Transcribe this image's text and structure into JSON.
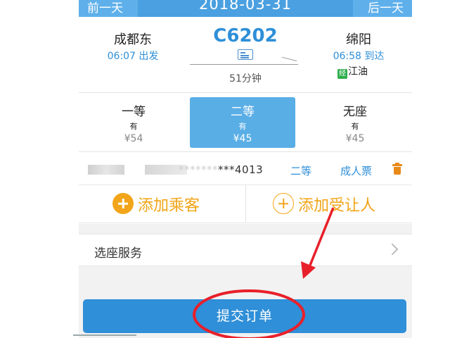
{
  "date_bar": {
    "prev_label": "前一天",
    "date": "2018-03-31",
    "next_label": "后一天"
  },
  "train": {
    "from_station": "成都东",
    "from_time": "06:07 出发",
    "train_no": "C6202",
    "duration": "51分钟",
    "to_station": "绵阳",
    "to_time": "06:58 到达",
    "via_badge": "经",
    "via_station": "江油"
  },
  "seats": [
    {
      "name": "一等",
      "availability": "有",
      "price": "¥54",
      "selected": false
    },
    {
      "name": "二等",
      "availability": "有",
      "price": "¥45",
      "selected": true
    },
    {
      "name": "无座",
      "availability": "有",
      "price": "¥45",
      "selected": false
    }
  ],
  "passenger": {
    "id_masked": "*******",
    "id_tail": "***4013",
    "seat_class": "二等",
    "ticket_type": "成人票"
  },
  "add": {
    "add_passenger": "添加乘客",
    "add_beneficiary": "添加受让人"
  },
  "service": {
    "label": "选座服务"
  },
  "submit": {
    "label": "提交订单"
  },
  "colors": {
    "accent": "#2f8fd8",
    "orange": "#f0a416",
    "annotation": "#e8202a"
  },
  "icons": [
    "document-icon",
    "arrow-icon",
    "via-badge-icon",
    "trash-icon",
    "add-circle-icon",
    "add-outline-icon",
    "chevron-right-icon"
  ]
}
